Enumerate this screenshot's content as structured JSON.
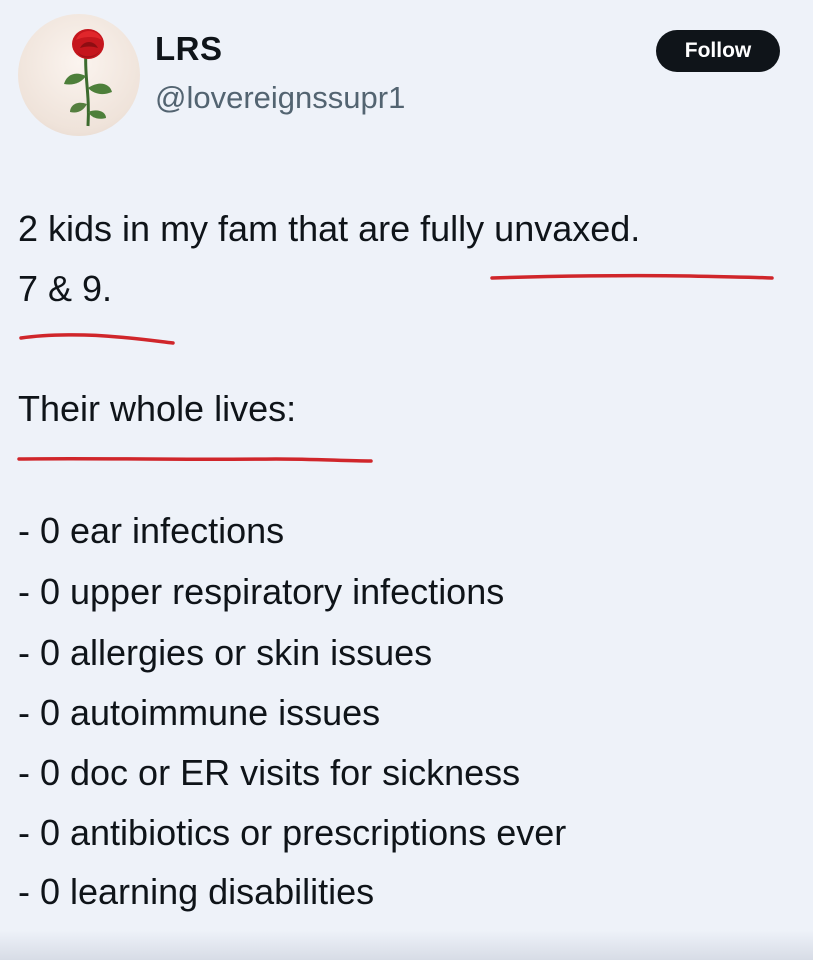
{
  "author": {
    "display_name": "LRS",
    "handle": "@lovereignssupr1",
    "avatar_icon": "rose-icon"
  },
  "actions": {
    "follow_label": "Follow"
  },
  "post": {
    "line_1": "2 kids in my fam that are fully unvaxed.",
    "line_2": "7 & 9.",
    "heading": "Their whole lives:",
    "items": [
      "- 0 ear infections",
      "- 0 upper respiratory infections",
      "- 0 allergies or skin issues",
      "- 0 autoimmune issues",
      "- 0 doc or ER visits for sickness",
      "- 0 antibiotics or prescriptions ever",
      "- 0 learning disabilities"
    ]
  },
  "colors": {
    "underline": "#d0262b",
    "follow_bg": "#0f1419",
    "background": "#eef2f9"
  }
}
